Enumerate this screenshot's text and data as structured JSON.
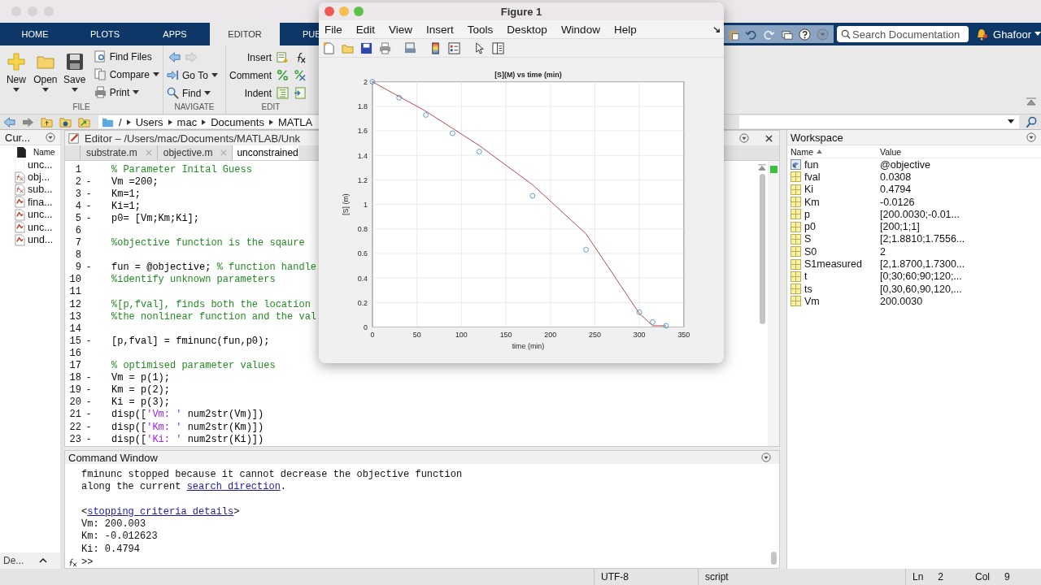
{
  "toolstrip_tabs": [
    {
      "label": "HOME",
      "selected": false
    },
    {
      "label": "PLOTS",
      "selected": false
    },
    {
      "label": "APPS",
      "selected": false
    },
    {
      "label": "EDITOR",
      "selected": true
    },
    {
      "label": "PUB",
      "selected": false
    }
  ],
  "search": {
    "placeholder": "Search Documentation"
  },
  "user": "Ghafoor",
  "ribbon": {
    "file": {
      "label": "FILE",
      "new": "New",
      "open": "Open",
      "save": "Save",
      "find_files": "Find Files",
      "compare": "Compare",
      "print": "Print"
    },
    "navigate": {
      "label": "NAVIGATE",
      "go_to": "Go To",
      "find": "Find"
    },
    "edit": {
      "label": "EDIT",
      "insert": "Insert",
      "comment": "Comment",
      "indent": "Indent"
    }
  },
  "address_bar": {
    "path": [
      "/",
      "Users",
      "mac",
      "Documents",
      "MATLA"
    ]
  },
  "current_folder": {
    "title": "Cur...",
    "column": "Name",
    "details": "De...",
    "files": [
      {
        "name": "unc...",
        "kind": "blank"
      },
      {
        "name": "obj...",
        "kind": "function"
      },
      {
        "name": "sub...",
        "kind": "function"
      },
      {
        "name": "fina...",
        "kind": "script"
      },
      {
        "name": "unc...",
        "kind": "script"
      },
      {
        "name": "unc...",
        "kind": "script"
      },
      {
        "name": "und...",
        "kind": "script"
      }
    ]
  },
  "editor": {
    "title": "Editor – /Users/mac/Documents/MATLAB/Unk",
    "tabs": [
      {
        "label": "substrate.m",
        "selected": false
      },
      {
        "label": "objective.m",
        "selected": false
      },
      {
        "label": "unconstrained",
        "selected": true
      }
    ],
    "lines": [
      {
        "number": "1",
        "segments": [
          {
            "text": "% Parameter Inital Guess",
            "kind": "comment"
          }
        ]
      },
      {
        "number": "2",
        "mark": "-",
        "segments": [
          {
            "text": "Vm =200;",
            "kind": "code"
          }
        ]
      },
      {
        "number": "3",
        "mark": "-",
        "segments": [
          {
            "text": "Km=1;",
            "kind": "code"
          }
        ]
      },
      {
        "number": "4",
        "mark": "-",
        "segments": [
          {
            "text": "Ki=1;",
            "kind": "code"
          }
        ]
      },
      {
        "number": "5",
        "mark": "-",
        "segments": [
          {
            "text": "p0= [Vm;Km;Ki];",
            "kind": "code"
          }
        ]
      },
      {
        "number": "6"
      },
      {
        "number": "7",
        "segments": [
          {
            "text": "%objective function is the sqaure",
            "kind": "comment"
          }
        ]
      },
      {
        "number": "8"
      },
      {
        "number": "9",
        "mark": "-",
        "segments": [
          {
            "text": "fun = @objective; ",
            "kind": "code"
          },
          {
            "text": "% function handle",
            "kind": "comment"
          }
        ]
      },
      {
        "number": "10",
        "segments": [
          {
            "text": "%identify unknown parameters",
            "kind": "comment"
          }
        ]
      },
      {
        "number": "11"
      },
      {
        "number": "12",
        "segments": [
          {
            "text": "%[p,fval], finds both the location",
            "kind": "comment"
          }
        ]
      },
      {
        "number": "13",
        "segments": [
          {
            "text": "%the nonlinear function and the val",
            "kind": "comment"
          }
        ]
      },
      {
        "number": "14"
      },
      {
        "number": "15",
        "mark": "-",
        "segments": [
          {
            "text": "[p,fval] = fminunc(fun,p0);",
            "kind": "code"
          }
        ]
      },
      {
        "number": "16"
      },
      {
        "number": "17",
        "segments": [
          {
            "text": "% optimised parameter values",
            "kind": "comment"
          }
        ]
      },
      {
        "number": "18",
        "mark": "-",
        "segments": [
          {
            "text": "Vm = p(1);",
            "kind": "code"
          }
        ]
      },
      {
        "number": "19",
        "mark": "-",
        "segments": [
          {
            "text": "Km = p(2);",
            "kind": "code"
          }
        ]
      },
      {
        "number": "20",
        "mark": "-",
        "segments": [
          {
            "text": "Ki = p(3);",
            "kind": "code"
          }
        ]
      },
      {
        "number": "21",
        "mark": "-",
        "segments": [
          {
            "text": "disp([",
            "kind": "code"
          },
          {
            "text": "'Vm: '",
            "kind": "string"
          },
          {
            "text": " num2str(Vm)])",
            "kind": "code"
          }
        ]
      },
      {
        "number": "22",
        "mark": "-",
        "segments": [
          {
            "text": "disp([",
            "kind": "code"
          },
          {
            "text": "'Km: '",
            "kind": "string"
          },
          {
            "text": " num2str(Km)])",
            "kind": "code"
          }
        ]
      },
      {
        "number": "23",
        "mark": "-",
        "segments": [
          {
            "text": "disp([",
            "kind": "code"
          },
          {
            "text": "'Ki: '",
            "kind": "string"
          },
          {
            "text": " num2str(Ki)])",
            "kind": "code"
          }
        ]
      }
    ]
  },
  "command_window": {
    "title": "Command Window",
    "prompt": ">>",
    "lines": [
      {
        "segments": [
          {
            "text": "fminunc stopped because it cannot decrease the objective function",
            "link": false
          }
        ]
      },
      {
        "segments": [
          {
            "text": "along the current ",
            "link": false
          },
          {
            "text": "search direction",
            "link": true
          },
          {
            "text": ".",
            "link": false
          }
        ]
      },
      {
        "blank_before": true,
        "segments": [
          {
            "text": "<",
            "link": false
          },
          {
            "text": "stopping criteria details",
            "link": true
          },
          {
            "text": ">",
            "link": false
          }
        ]
      },
      {
        "segments": [
          {
            "text": "Vm: 200.003",
            "link": false
          }
        ]
      },
      {
        "segments": [
          {
            "text": "Km: -0.012623",
            "link": false
          }
        ]
      },
      {
        "segments": [
          {
            "text": "Ki: 0.4794",
            "link": false
          }
        ]
      }
    ]
  },
  "workspace": {
    "title": "Workspace",
    "columns": [
      "Name",
      "Value"
    ],
    "rows": [
      {
        "name": "fun",
        "value": "@objective",
        "kind": "handle"
      },
      {
        "name": "fval",
        "value": "0.0308",
        "kind": "array"
      },
      {
        "name": "Ki",
        "value": "0.4794",
        "kind": "array"
      },
      {
        "name": "Km",
        "value": "-0.0126",
        "kind": "array"
      },
      {
        "name": "p",
        "value": "[200.0030;-0.01...",
        "kind": "array"
      },
      {
        "name": "p0",
        "value": "[200;1;1]",
        "kind": "array"
      },
      {
        "name": "S",
        "value": "[2;1.8810;1.7556...",
        "kind": "array"
      },
      {
        "name": "S0",
        "value": "2",
        "kind": "array"
      },
      {
        "name": "S1measured",
        "value": "[2,1.8700,1.7300...",
        "kind": "array"
      },
      {
        "name": "t",
        "value": "[0;30;60;90;120;...",
        "kind": "array"
      },
      {
        "name": "ts",
        "value": "[0,30,60,90,120,...",
        "kind": "array"
      },
      {
        "name": "Vm",
        "value": "200.0030",
        "kind": "array"
      }
    ]
  },
  "status_bar": {
    "encoding": "UTF-8",
    "file_type": "script",
    "ln_label": "Ln",
    "ln": "2",
    "col_label": "Col",
    "col": "9"
  },
  "figure": {
    "title": "Figure 1",
    "menu": [
      "File",
      "Edit",
      "View",
      "Insert",
      "Tools",
      "Desktop",
      "Window",
      "Help"
    ],
    "chart_data": {
      "type": "line",
      "title": "[S](M) vs time (min)",
      "xlabel": "time (min)",
      "ylabel": "[S] (m)",
      "x": [
        0,
        30,
        60,
        90,
        120,
        180,
        240,
        300,
        315,
        330
      ],
      "grid": true,
      "series": [
        {
          "type": "line",
          "color": "#b5474b",
          "values": [
            2,
            1.88,
            1.76,
            1.62,
            1.48,
            1.16,
            0.76,
            0.11,
            0.01,
            0.01
          ]
        },
        {
          "type": "scatter",
          "color": "#4a90c8",
          "values": [
            2,
            1.87,
            1.73,
            1.58,
            1.43,
            1.07,
            0.63,
            0.12,
            0.04,
            0.01
          ]
        }
      ],
      "xlim": [
        0,
        350
      ],
      "ylim": [
        0,
        2
      ],
      "xticks": [
        0,
        50,
        100,
        150,
        200,
        250,
        300,
        350
      ],
      "yticks": [
        0,
        0.2,
        0.4,
        0.6,
        0.8,
        1,
        1.2,
        1.4,
        1.6,
        1.8,
        2
      ]
    }
  }
}
